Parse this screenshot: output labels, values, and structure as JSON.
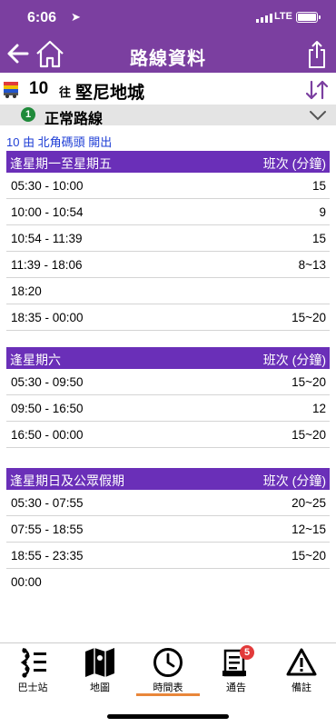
{
  "status_bar": {
    "time": "6:06",
    "network": "LTE"
  },
  "nav": {
    "title": "路線資料"
  },
  "route": {
    "number": "10",
    "direction_prefix": "往",
    "destination": "堅尼地城"
  },
  "variant": {
    "badge": "1",
    "label": "正常路線"
  },
  "origin_text": "10 由 北角碼頭 開出",
  "timetable": [
    {
      "day": "逢星期一至星期五",
      "frequency_header": "班次 (分鐘)",
      "rows": [
        {
          "period": "05:30 - 10:00",
          "interval": "15"
        },
        {
          "period": "10:00 - 10:54",
          "interval": "9"
        },
        {
          "period": "10:54 - 11:39",
          "interval": "15"
        },
        {
          "period": "11:39 - 18:06",
          "interval": "8~13"
        },
        {
          "period": "18:20",
          "interval": ""
        },
        {
          "period": "18:35 - 00:00",
          "interval": "15~20"
        }
      ]
    },
    {
      "day": "逢星期六",
      "frequency_header": "班次 (分鐘)",
      "rows": [
        {
          "period": "05:30 - 09:50",
          "interval": "15~20"
        },
        {
          "period": "09:50 - 16:50",
          "interval": "12"
        },
        {
          "period": "16:50 - 00:00",
          "interval": "15~20"
        }
      ]
    },
    {
      "day": "逢星期日及公眾假期",
      "frequency_header": "班次 (分鐘)",
      "rows": [
        {
          "period": "05:30 - 07:55",
          "interval": "20~25"
        },
        {
          "period": "07:55 - 18:55",
          "interval": "12~15"
        },
        {
          "period": "18:55 - 23:35",
          "interval": "15~20"
        },
        {
          "period": "00:00",
          "interval": ""
        }
      ]
    }
  ],
  "tabs": [
    {
      "label": "巴士站",
      "icon": "bus-stops-icon"
    },
    {
      "label": "地圖",
      "icon": "map-icon"
    },
    {
      "label": "時間表",
      "icon": "clock-icon",
      "active": true
    },
    {
      "label": "通告",
      "icon": "notice-icon",
      "badge": "5"
    },
    {
      "label": "備註",
      "icon": "warning-icon"
    }
  ],
  "colors": {
    "header_purple": "#7b3fa0",
    "section_purple": "#6a2fb8",
    "origin_blue": "#1f3fd6",
    "active_tab_underline": "#e9873a",
    "badge_red": "#e23a3a",
    "variant_badge_green": "#1f8a3a"
  }
}
